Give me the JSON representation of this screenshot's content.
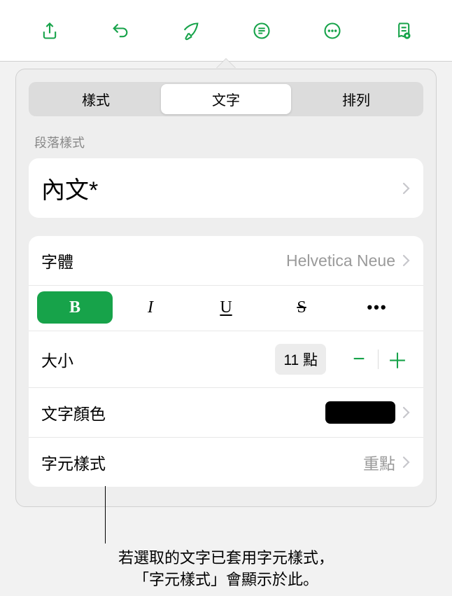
{
  "toolbar": {
    "share": "share-icon",
    "undo": "undo-icon",
    "format": "format-brush-icon",
    "list": "list-icon",
    "more": "more-icon",
    "doc": "document-icon"
  },
  "tabs": {
    "style": "樣式",
    "text": "文字",
    "arrange": "排列"
  },
  "sections": {
    "paragraph_style_label": "段落樣式",
    "paragraph_style_value": "內文*"
  },
  "font": {
    "label": "字體",
    "value": "Helvetica Neue"
  },
  "format_buttons": {
    "bold": "B",
    "italic": "I",
    "underline": "U",
    "strike": "S",
    "more": "•••"
  },
  "size": {
    "label": "大小",
    "value": "11 點",
    "minus": "−",
    "plus": "＋"
  },
  "text_color": {
    "label": "文字顏色",
    "swatch": "#000000"
  },
  "char_style": {
    "label": "字元樣式",
    "value": "重點"
  },
  "callout": {
    "line1": "若選取的文字已套用字元樣式，",
    "line2": "「字元樣式」會顯示於此。"
  }
}
